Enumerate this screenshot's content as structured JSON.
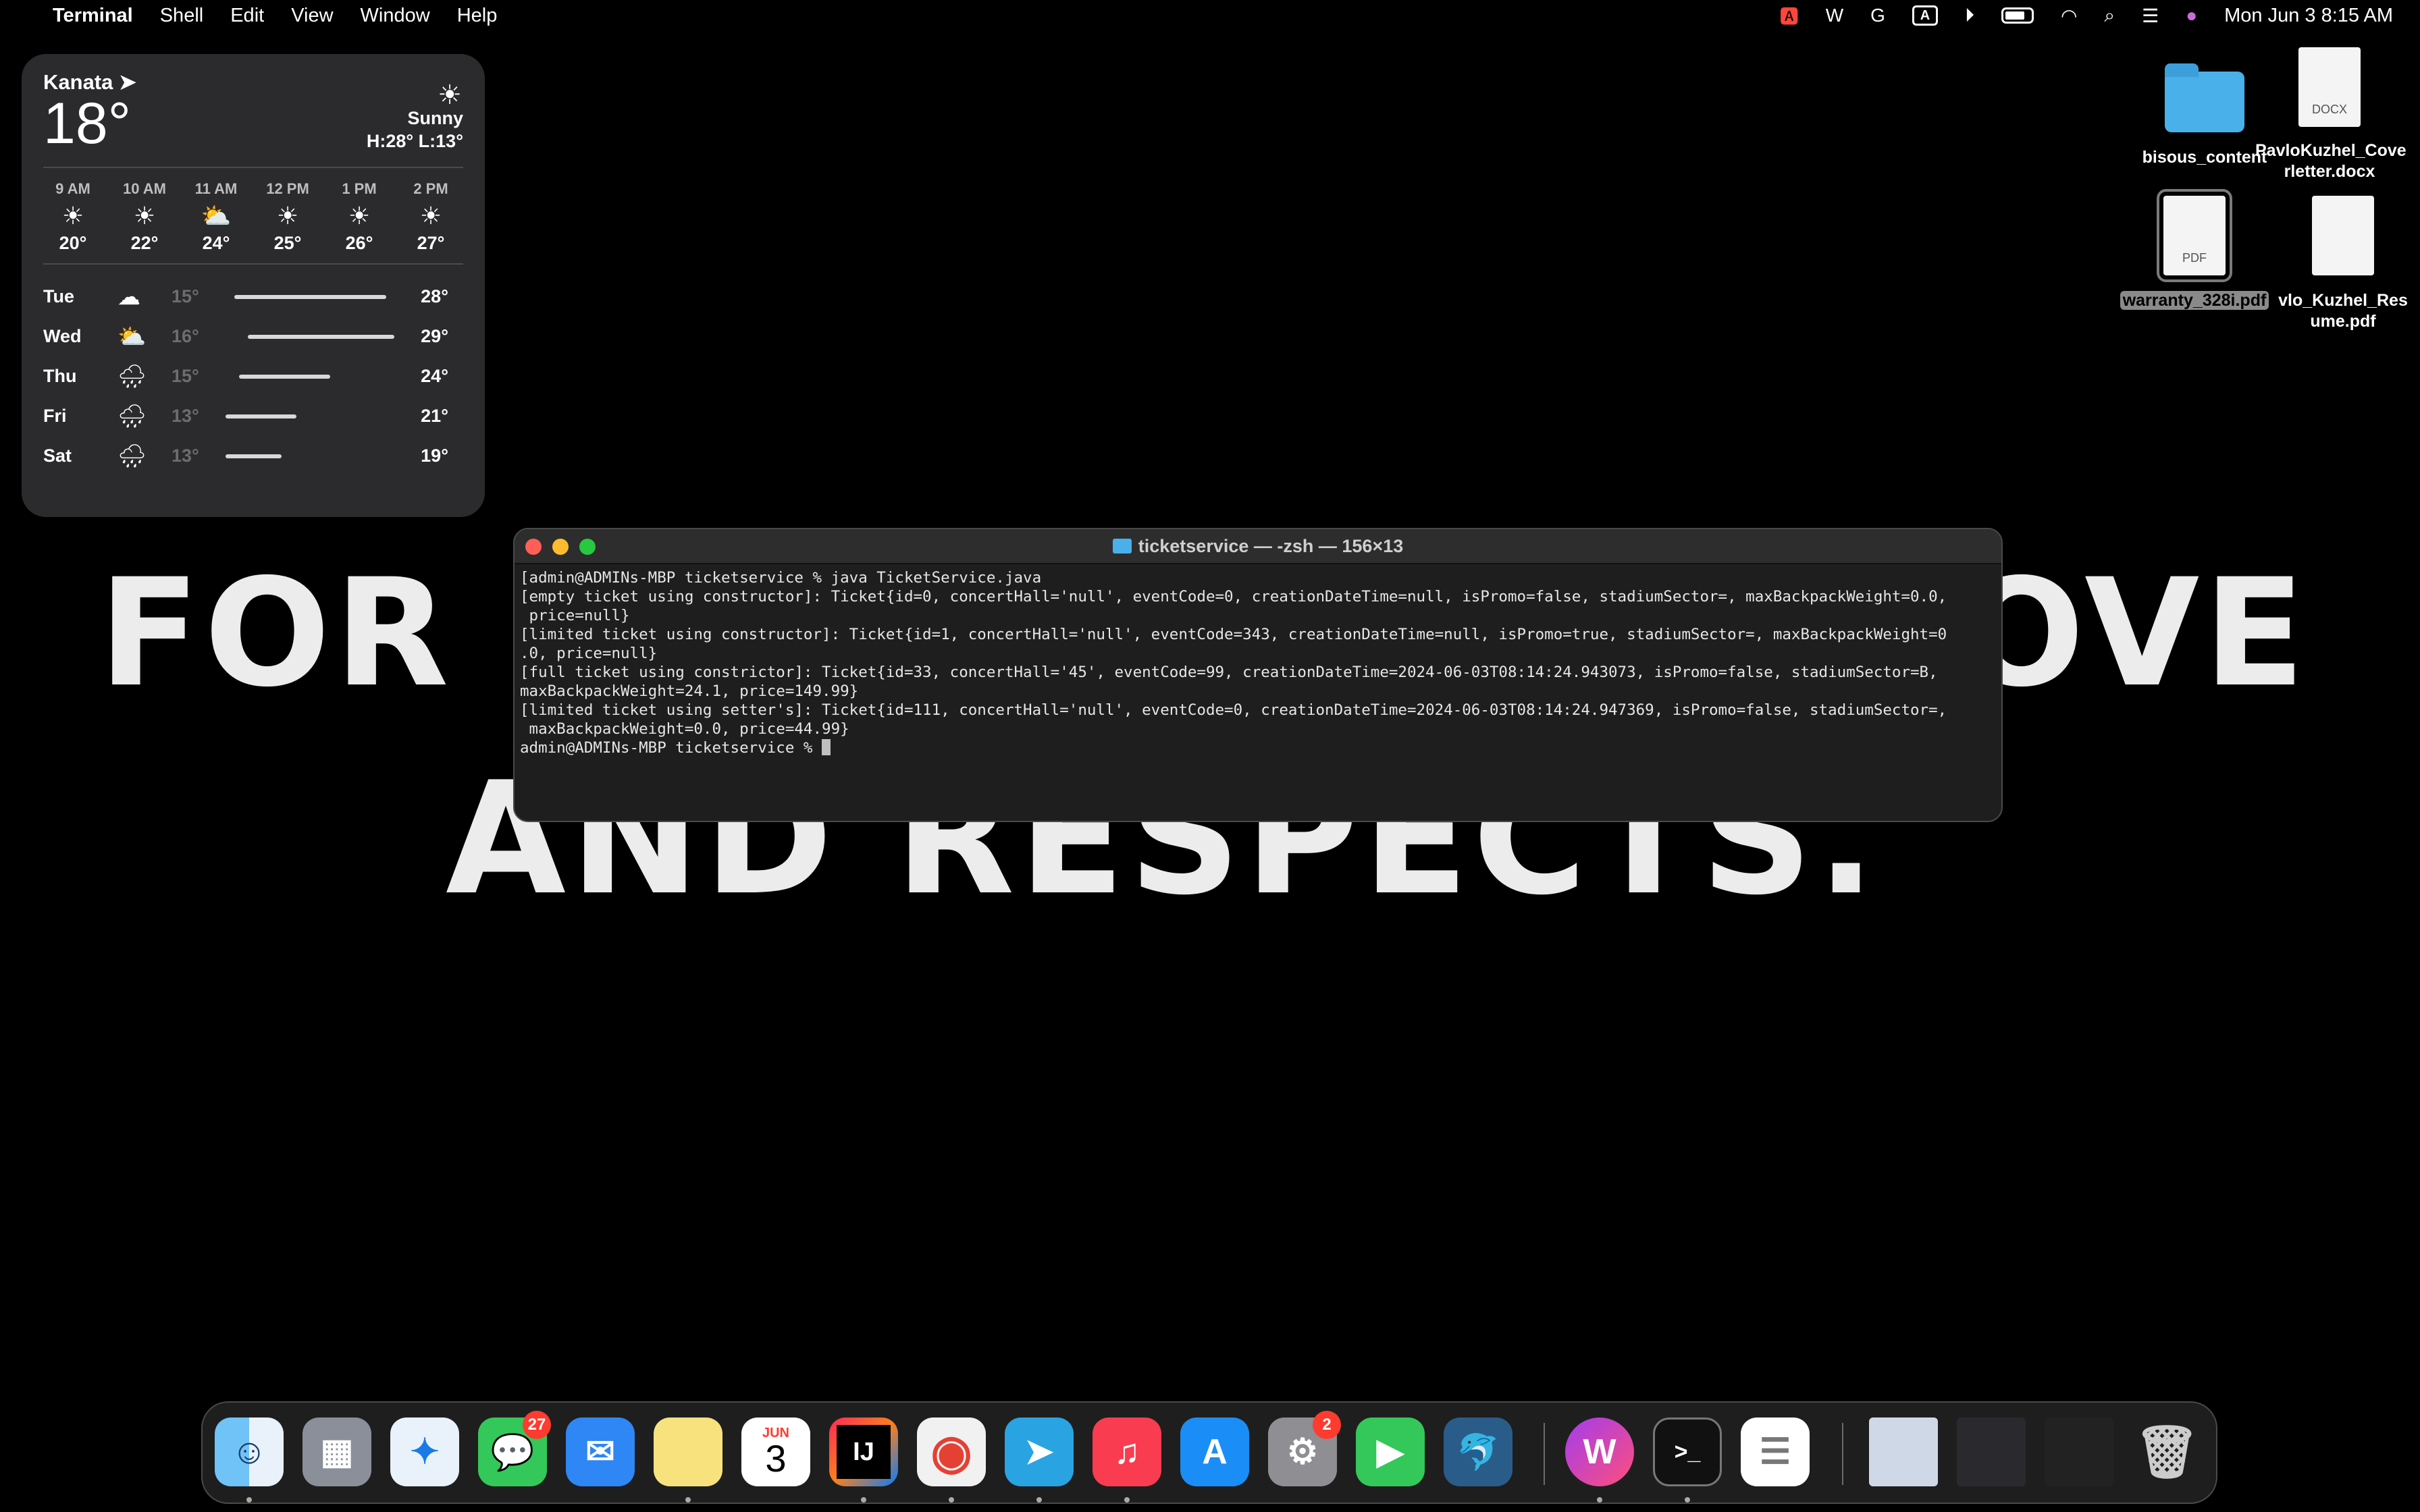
{
  "wallpaper": {
    "line1_left": "FOR",
    "line1_right": "OVE",
    "line2": "AND RESPECTS."
  },
  "menubar": {
    "app_name": "Terminal",
    "menus": [
      "Shell",
      "Edit",
      "View",
      "Window",
      "Help"
    ],
    "status_icons": [
      "cc-badge-icon",
      "wps-icon",
      "grammarly-icon",
      "input-source-icon",
      "play-icon",
      "battery-icon",
      "wifi-icon",
      "search-icon",
      "control-center-icon",
      "siri-icon"
    ],
    "input_source_letter": "A",
    "clock": "Mon Jun 3  8:15 AM"
  },
  "weather": {
    "city": "Kanata",
    "temperature": "18°",
    "condition": "Sunny",
    "high_low": "H:28° L:13°",
    "hourly": [
      {
        "time": "9 AM",
        "icon": "sun",
        "temp": "20°"
      },
      {
        "time": "10 AM",
        "icon": "sun",
        "temp": "22°"
      },
      {
        "time": "11 AM",
        "icon": "partly-cloudy",
        "temp": "24°"
      },
      {
        "time": "12 PM",
        "icon": "sun",
        "temp": "25°"
      },
      {
        "time": "1 PM",
        "icon": "sun",
        "temp": "26°"
      },
      {
        "time": "2 PM",
        "icon": "sun",
        "temp": "27°"
      }
    ],
    "daily": [
      {
        "day": "Tue",
        "icon": "cloud",
        "low": "15°",
        "high": "28°",
        "range_start": 0.05,
        "range_end": 0.95
      },
      {
        "day": "Wed",
        "icon": "partly-cloudy",
        "low": "16°",
        "high": "29°",
        "range_start": 0.13,
        "range_end": 1.0
      },
      {
        "day": "Thu",
        "icon": "rain",
        "low": "15°",
        "high": "24°",
        "range_start": 0.08,
        "range_end": 0.62
      },
      {
        "day": "Fri",
        "icon": "rain",
        "low": "13°",
        "high": "21°",
        "range_start": 0.0,
        "range_end": 0.42
      },
      {
        "day": "Sat",
        "icon": "rain",
        "low": "13°",
        "high": "19°",
        "range_start": 0.0,
        "range_end": 0.33
      }
    ]
  },
  "desktop": {
    "items": [
      {
        "label": "bisous_content",
        "type": "folder"
      },
      {
        "label": "PavloKuzhel_Coverletter.docx",
        "line1": "PavloKuzhel_Cove",
        "line2": "rletter.docx",
        "type": "docx",
        "badge": "DOCX"
      },
      {
        "label": "warranty_328i.pdf",
        "type": "pdf",
        "badge": "PDF",
        "selected": true
      },
      {
        "label": "Pavlo_Kuzhel_Resume.pdf",
        "line1": "vlo_Kuzhel_Res",
        "line2": "ume.pdf",
        "type": "pdf"
      }
    ]
  },
  "terminal": {
    "title": "ticketservice — -zsh — 156×13",
    "lines": [
      "[admin@ADMINs-MBP ticketservice % java TicketService.java",
      "[empty ticket using constructor]: Ticket{id=0, concertHall='null', eventCode=0, creationDateTime=null, isPromo=false, stadiumSector=, maxBackpackWeight=0.0,",
      " price=null}",
      "[limited ticket using constructor]: Ticket{id=1, concertHall='null', eventCode=343, creationDateTime=null, isPromo=true, stadiumSector=, maxBackpackWeight=0",
      ".0, price=null}",
      "[full ticket using constrictor]: Ticket{id=33, concertHall='45', eventCode=99, creationDateTime=2024-06-03T08:14:24.943073, isPromo=false, stadiumSector=B,",
      "maxBackpackWeight=24.1, price=149.99}",
      "[limited ticket using setter's]: Ticket{id=111, concertHall='null', eventCode=0, creationDateTime=2024-06-03T08:14:24.947369, isPromo=false, stadiumSector=,",
      " maxBackpackWeight=0.0, price=44.99}"
    ],
    "prompt": "admin@ADMINs-MBP ticketservice % "
  },
  "dock": {
    "apps": [
      {
        "name": "finder",
        "running": true
      },
      {
        "name": "launchpad",
        "running": false
      },
      {
        "name": "safari",
        "running": false
      },
      {
        "name": "messages",
        "running": false,
        "badge": "27"
      },
      {
        "name": "mail",
        "running": false
      },
      {
        "name": "notes",
        "running": true
      },
      {
        "name": "calendar",
        "running": false,
        "month": "JUN",
        "date": "3"
      },
      {
        "name": "intellij",
        "running": true,
        "text": "IJ"
      },
      {
        "name": "chrome",
        "running": true
      },
      {
        "name": "telegram",
        "running": true
      },
      {
        "name": "music",
        "running": true
      },
      {
        "name": "app-store",
        "running": false
      },
      {
        "name": "system-settings",
        "running": false,
        "badge": "2"
      },
      {
        "name": "facetime",
        "running": false
      },
      {
        "name": "mysql-workbench",
        "running": false
      },
      {
        "name": "wps-office",
        "running": true
      },
      {
        "name": "terminal",
        "running": true,
        "text": ">_"
      },
      {
        "name": "reminders",
        "running": false
      },
      {
        "name": "telegram-window",
        "running": false
      },
      {
        "name": "wps-window",
        "running": false
      },
      {
        "name": "music-window",
        "running": false
      },
      {
        "name": "trash",
        "running": false
      }
    ]
  }
}
